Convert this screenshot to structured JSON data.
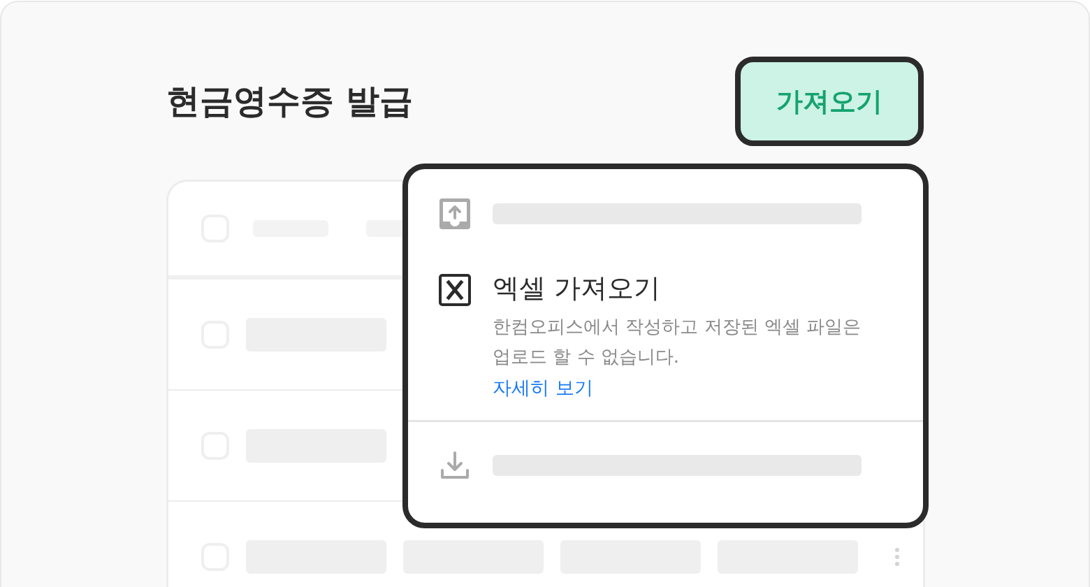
{
  "page": {
    "title": "현금영수증 발급"
  },
  "import_button": {
    "label": "가져오기"
  },
  "table": {
    "header": {
      "checked": false
    },
    "rows": [
      {
        "checked": false
      },
      {
        "checked": false
      },
      {
        "checked": false
      }
    ]
  },
  "menu": {
    "items": [
      {
        "kind": "upload"
      },
      {
        "kind": "excel",
        "title": "엑셀 가져오기",
        "description": "한컴오피스에서 작성하고 저장된 엑셀 파일은 업로드 할 수 없습니다.",
        "link": "자세히 보기"
      },
      {
        "kind": "download"
      }
    ]
  }
}
